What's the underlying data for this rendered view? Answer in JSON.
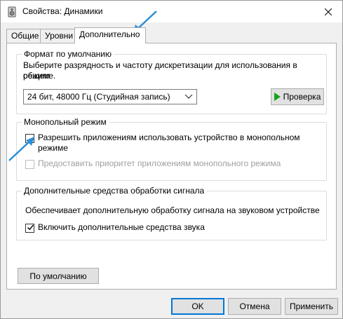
{
  "window": {
    "title": "Свойства: Динамики",
    "icons": {
      "app": "speaker-icon",
      "close": "close-icon"
    }
  },
  "tabs": [
    {
      "label": "Общие"
    },
    {
      "label": "Уровни"
    },
    {
      "label": "Дополнительно",
      "selected": true
    }
  ],
  "format_group": {
    "title": "Формат по умолчанию",
    "description_line1": "Выберите разрядность и частоту дискретизации для использования в общем",
    "description_line2": "режиме.",
    "selected_format": "24 бит, 48000 Гц (Студийная запись)",
    "test_button": "Проверка"
  },
  "exclusive_group": {
    "title": "Монопольный режим",
    "allow_label_line1": "Разрешить приложениям использовать устройство в монопольном",
    "allow_label_line2": "режиме",
    "allow_checked": false,
    "priority_label": "Предоставить приоритет приложениям монопольного режима",
    "priority_checked": false,
    "priority_enabled": false
  },
  "enhancements_group": {
    "title": "Дополнительные средства обработки сигнала",
    "description": "Обеспечивает дополнительную обработку сигнала на звуковом устройстве",
    "enable_label": "Включить дополнительные средства звука",
    "enable_checked": true
  },
  "restore_defaults_button": "По умолчанию",
  "dialog_buttons": {
    "ok": "OK",
    "cancel": "Отмена",
    "apply": "Применить"
  },
  "colors": {
    "accent": "#0078d7",
    "annotation_arrow": "#2b8fd6",
    "play_green": "#17a31b"
  }
}
